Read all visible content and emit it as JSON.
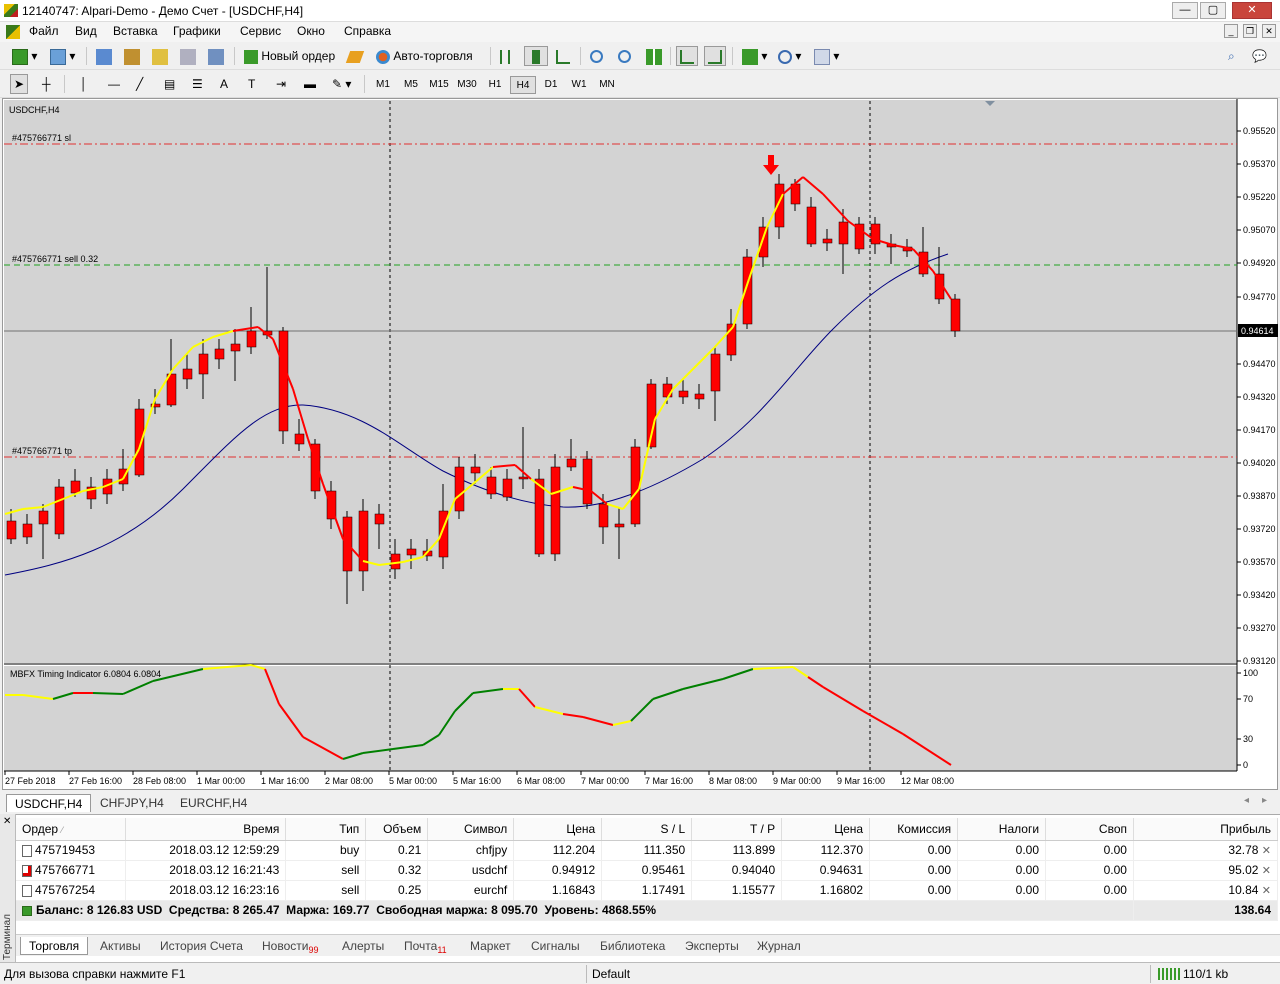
{
  "window": {
    "title": "12140747: Alpari-Demo - Демо Счет - [USDCHF,H4]",
    "minimize": "—",
    "maximize": "▢",
    "close": "✕"
  },
  "menu": [
    "Файл",
    "Вид",
    "Вставка",
    "Графики",
    "Сервис",
    "Окно",
    "Справка"
  ],
  "toolbar": {
    "new_order": "Новый ордер",
    "autotrade": "Авто-торговля"
  },
  "timeframes": [
    "M1",
    "M5",
    "M15",
    "M30",
    "H1",
    "H4",
    "D1",
    "W1",
    "MN"
  ],
  "timeframe_selected": "H4",
  "chart": {
    "symbol_label": "USDCHF,H4",
    "sl_label": "#475766771 sl",
    "entry_label": "#475766771 sell 0.32",
    "tp_label": "#475766771 tp",
    "current_price": "0.94614",
    "indicator_label": "MBFX Timing Indicator 6.0804 6.0804",
    "price_ticks": [
      "0.95520",
      "0.95370",
      "0.95220",
      "0.95070",
      "0.94920",
      "0.94770",
      "0.94614",
      "0.94470",
      "0.94320",
      "0.94170",
      "0.94020",
      "0.93870",
      "0.93720",
      "0.93570",
      "0.93420",
      "0.93270",
      "0.93120"
    ],
    "indicator_ticks": [
      "100",
      "70",
      "30",
      "0"
    ],
    "time_ticks": [
      "27 Feb 2018",
      "27 Feb 16:00",
      "28 Feb 08:00",
      "1 Mar 00:00",
      "1 Mar 16:00",
      "2 Mar 08:00",
      "5 Mar 00:00",
      "5 Mar 16:00",
      "6 Mar 08:00",
      "7 Mar 00:00",
      "7 Mar 16:00",
      "8 Mar 08:00",
      "9 Mar 00:00",
      "9 Mar 16:00",
      "12 Mar 08:00"
    ],
    "colors": {
      "bull": "#0000c0",
      "bear": "#ff0000",
      "bg": "#d3d3d3",
      "ma_fast_up": "#ffff00",
      "ma_fast_down": "#ff0000",
      "ma_slow": "#000080",
      "sl": "#e03030",
      "entry": "#20a020",
      "tp": "#e03030"
    }
  },
  "chart_tabs": [
    "USDCHF,H4",
    "CHFJPY,H4",
    "EURCHF,H4"
  ],
  "orders": {
    "headers": [
      "Ордер",
      "Время",
      "Тип",
      "Объем",
      "Символ",
      "Цена",
      "S / L",
      "T / P",
      "Цена",
      "Комиссия",
      "Налоги",
      "Своп",
      "Прибыль"
    ],
    "rows": [
      {
        "order": "475719453",
        "time": "2018.03.12 12:59:29",
        "type": "buy",
        "volume": "0.21",
        "symbol": "chfjpy",
        "price": "112.204",
        "sl": "111.350",
        "tp": "113.899",
        "cur": "112.370",
        "commission": "0.00",
        "taxes": "0.00",
        "swap": "0.00",
        "profit": "32.78"
      },
      {
        "order": "475766771",
        "time": "2018.03.12 16:21:43",
        "type": "sell",
        "volume": "0.32",
        "symbol": "usdchf",
        "price": "0.94912",
        "sl": "0.95461",
        "tp": "0.94040",
        "cur": "0.94631",
        "commission": "0.00",
        "taxes": "0.00",
        "swap": "0.00",
        "profit": "95.02"
      },
      {
        "order": "475767254",
        "time": "2018.03.12 16:23:16",
        "type": "sell",
        "volume": "0.25",
        "symbol": "eurchf",
        "price": "1.16843",
        "sl": "1.17491",
        "tp": "1.15577",
        "cur": "1.16802",
        "commission": "0.00",
        "taxes": "0.00",
        "swap": "0.00",
        "profit": "10.84"
      }
    ],
    "balance_line": "Баланс: 8 126.83 USD  Средства: 8 265.47  Маржа: 169.77  Свободная маржа: 8 095.70  Уровень: 4868.55%",
    "total_profit": "138.64"
  },
  "terminal_label": "Терминал",
  "terminal_tabs": [
    {
      "label": "Торговля",
      "badge": ""
    },
    {
      "label": "Активы",
      "badge": ""
    },
    {
      "label": "История Счета",
      "badge": ""
    },
    {
      "label": "Новости",
      "badge": "99"
    },
    {
      "label": "Алерты",
      "badge": ""
    },
    {
      "label": "Почта",
      "badge": "11"
    },
    {
      "label": "Маркет",
      "badge": ""
    },
    {
      "label": "Сигналы",
      "badge": ""
    },
    {
      "label": "Библиотека",
      "badge": ""
    },
    {
      "label": "Эксперты",
      "badge": ""
    },
    {
      "label": "Журнал",
      "badge": ""
    }
  ],
  "status": {
    "help": "Для вызова справки нажмите F1",
    "profile": "Default",
    "traffic": "110/1 kb"
  }
}
